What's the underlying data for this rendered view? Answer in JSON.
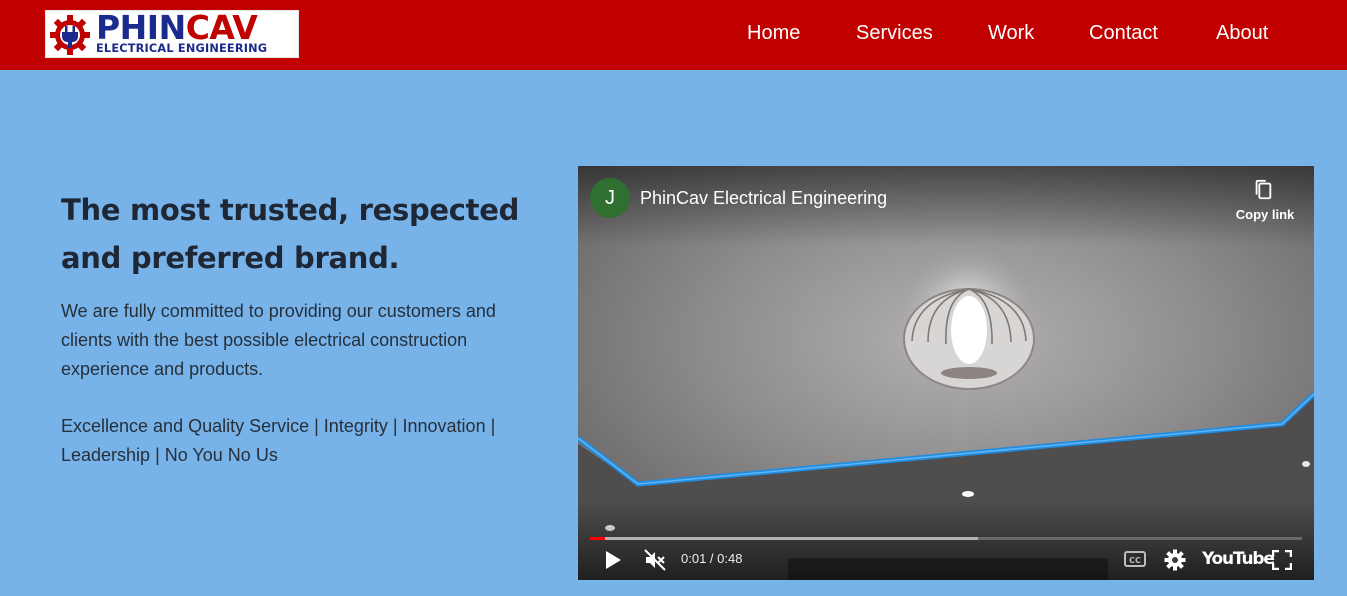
{
  "header": {
    "logo": {
      "word_part1": "PHIN",
      "word_part2": "CAV",
      "subtitle": "ELECTRICAL ENGINEERING",
      "icon": "gear-plug-logo-icon"
    },
    "nav": [
      "Home",
      "Services",
      "Work",
      "Contact",
      "About"
    ]
  },
  "hero": {
    "headline": "The most trusted, respected and preferred brand.",
    "paragraph": "We are fully committed to providing our customers and clients with the best possible electrical construction experience and products.",
    "values": "Excellence and Quality Service | Integrity | Innovation | Leadership | No You No Us"
  },
  "video": {
    "channel_initial": "J",
    "title": "PhinCav Electrical Engineering",
    "copy_link_label": "Copy link",
    "time": "0:01 / 0:48",
    "progress_fraction": 0.021,
    "buffered_fraction": 0.545,
    "brand_label": "YouTube",
    "icons": [
      "copy-icon",
      "play-icon",
      "volume-muted-icon",
      "captions-icon",
      "settings-gear-icon",
      "fullscreen-icon"
    ]
  },
  "colors": {
    "header_red": "#c10000",
    "page_blue": "#77b2e9",
    "logo_blue": "#1b2a8d",
    "led_blue": "#1f8de0",
    "avatar_green": "#2f6f2f"
  }
}
